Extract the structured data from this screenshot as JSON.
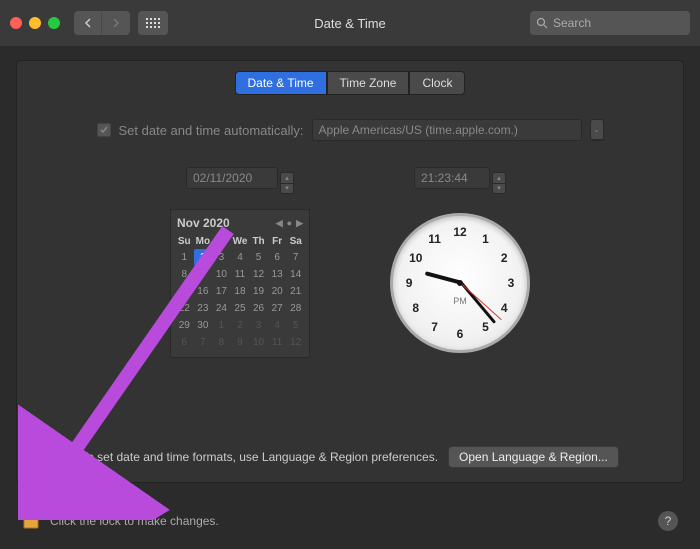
{
  "window": {
    "title": "Date & Time",
    "search_placeholder": "Search"
  },
  "tabs": {
    "date_time": "Date & Time",
    "time_zone": "Time Zone",
    "clock": "Clock"
  },
  "auto": {
    "checkbox_checked": true,
    "label": "Set date and time automatically:",
    "server": "Apple Americas/US (time.apple.com.)"
  },
  "date": {
    "value": "02/11/2020",
    "month_label": "Nov 2020",
    "weekdays": [
      "Su",
      "Mo",
      "Tu",
      "We",
      "Th",
      "Fr",
      "Sa"
    ],
    "weeks": [
      [
        {
          "n": 1
        },
        {
          "n": 2,
          "sel": true
        },
        {
          "n": 3
        },
        {
          "n": 4
        },
        {
          "n": 5
        },
        {
          "n": 6
        },
        {
          "n": 7
        }
      ],
      [
        {
          "n": 8
        },
        {
          "n": 9
        },
        {
          "n": 10
        },
        {
          "n": 11
        },
        {
          "n": 12
        },
        {
          "n": 13
        },
        {
          "n": 14
        }
      ],
      [
        {
          "n": 15
        },
        {
          "n": 16
        },
        {
          "n": 17
        },
        {
          "n": 18
        },
        {
          "n": 19
        },
        {
          "n": 20
        },
        {
          "n": 21
        }
      ],
      [
        {
          "n": 22
        },
        {
          "n": 23
        },
        {
          "n": 24
        },
        {
          "n": 25
        },
        {
          "n": 26
        },
        {
          "n": 27
        },
        {
          "n": 28
        }
      ],
      [
        {
          "n": 29
        },
        {
          "n": 30
        },
        {
          "n": 1,
          "out": true
        },
        {
          "n": 2,
          "out": true
        },
        {
          "n": 3,
          "out": true
        },
        {
          "n": 4,
          "out": true
        },
        {
          "n": 5,
          "out": true
        }
      ],
      [
        {
          "n": 6,
          "out": true
        },
        {
          "n": 7,
          "out": true
        },
        {
          "n": 8,
          "out": true
        },
        {
          "n": 9,
          "out": true
        },
        {
          "n": 10,
          "out": true
        },
        {
          "n": 11,
          "out": true
        },
        {
          "n": 12,
          "out": true
        }
      ]
    ]
  },
  "time": {
    "value": "21:23:44",
    "ampm": "PM"
  },
  "footer": {
    "hint": "To set date and time formats, use Language & Region preferences.",
    "open_button": "Open Language & Region..."
  },
  "lock": {
    "text": "Click the lock to make changes."
  },
  "help": {
    "label": "?"
  },
  "colors": {
    "accent": "#2f6fe0",
    "annotation": "#b84bdc"
  }
}
